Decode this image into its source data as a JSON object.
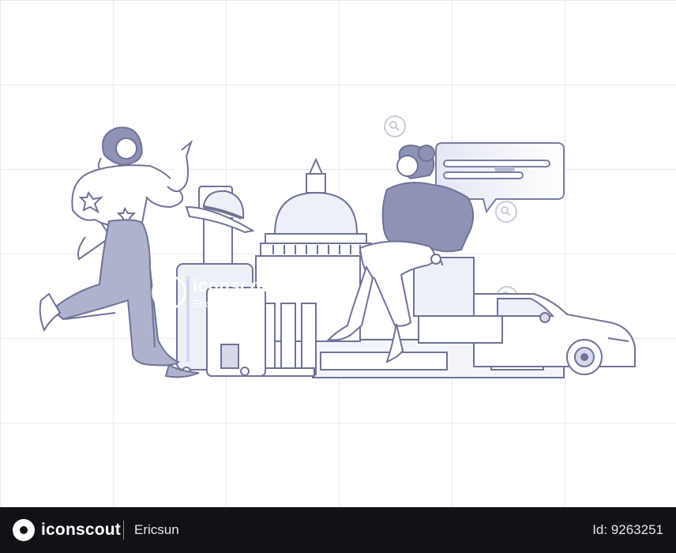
{
  "watermark": {
    "brand": "iconscout",
    "author": "Ericsun"
  },
  "footer": {
    "brand": "iconscout",
    "author": "Ericsun",
    "asset_id": "Id: 9263251"
  },
  "colors": {
    "line": "#6f7396",
    "fill_dark": "#8e93b6",
    "fill_light": "#d7d9ea",
    "fill_pale": "#eef0f8",
    "footer_bg": "#111216"
  }
}
